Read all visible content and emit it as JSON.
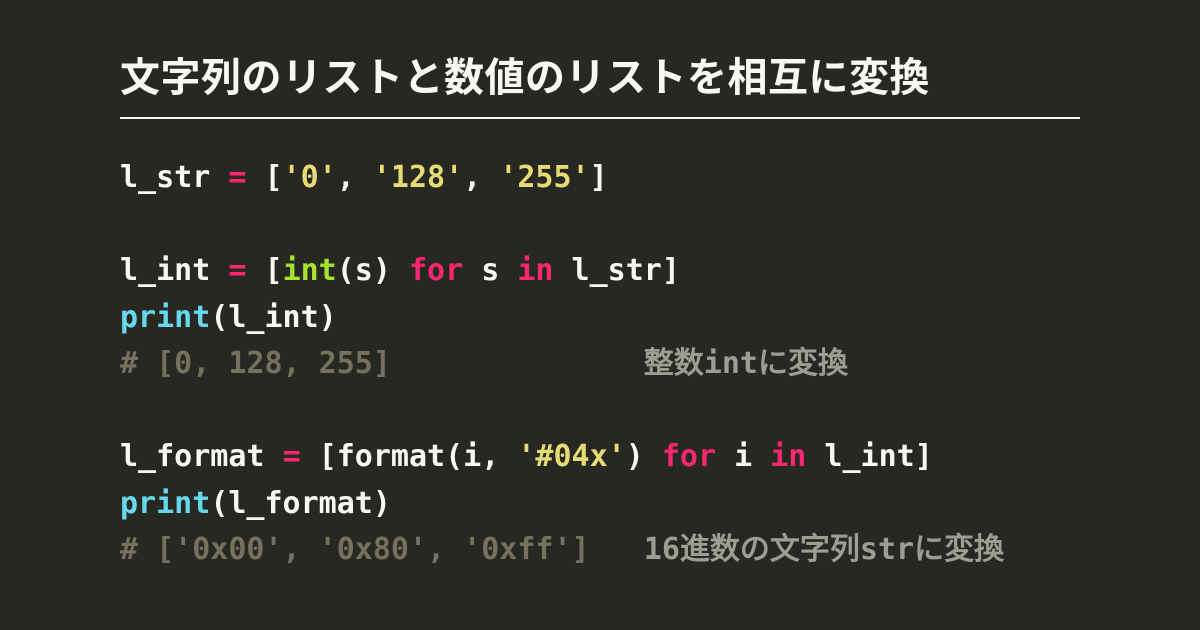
{
  "title": "文字列のリストと数値のリストを相互に変換",
  "code": {
    "lines": [
      {
        "spans": [
          {
            "cls": "tok-var",
            "t": "l_str "
          },
          {
            "cls": "tok-op",
            "t": "="
          },
          {
            "cls": "tok-punc",
            "t": " ["
          },
          {
            "cls": "tok-str",
            "t": "'0'"
          },
          {
            "cls": "tok-punc",
            "t": ", "
          },
          {
            "cls": "tok-str",
            "t": "'128'"
          },
          {
            "cls": "tok-punc",
            "t": ", "
          },
          {
            "cls": "tok-str",
            "t": "'255'"
          },
          {
            "cls": "tok-punc",
            "t": "]"
          }
        ]
      },
      {
        "spans": [
          {
            "cls": "",
            "t": ""
          }
        ]
      },
      {
        "spans": [
          {
            "cls": "tok-var",
            "t": "l_int "
          },
          {
            "cls": "tok-op",
            "t": "="
          },
          {
            "cls": "tok-punc",
            "t": " ["
          },
          {
            "cls": "tok-builtin",
            "t": "int"
          },
          {
            "cls": "tok-punc",
            "t": "(s) "
          },
          {
            "cls": "tok-kw",
            "t": "for"
          },
          {
            "cls": "tok-var",
            "t": " s "
          },
          {
            "cls": "tok-kw",
            "t": "in"
          },
          {
            "cls": "tok-var",
            "t": " l_str"
          },
          {
            "cls": "tok-punc",
            "t": "]"
          }
        ]
      },
      {
        "spans": [
          {
            "cls": "tok-fn",
            "t": "print"
          },
          {
            "cls": "tok-punc",
            "t": "(l_int)"
          }
        ]
      },
      {
        "spans": [
          {
            "cls": "tok-comment",
            "t": "# [0, 128, 255]              "
          },
          {
            "cls": "annot",
            "t": "整数intに変換"
          }
        ]
      },
      {
        "spans": [
          {
            "cls": "",
            "t": ""
          }
        ]
      },
      {
        "spans": [
          {
            "cls": "tok-var",
            "t": "l_format "
          },
          {
            "cls": "tok-op",
            "t": "="
          },
          {
            "cls": "tok-punc",
            "t": " [format(i, "
          },
          {
            "cls": "tok-str",
            "t": "'#04x'"
          },
          {
            "cls": "tok-punc",
            "t": ") "
          },
          {
            "cls": "tok-kw",
            "t": "for"
          },
          {
            "cls": "tok-var",
            "t": " i "
          },
          {
            "cls": "tok-kw",
            "t": "in"
          },
          {
            "cls": "tok-var",
            "t": " l_int"
          },
          {
            "cls": "tok-punc",
            "t": "]"
          }
        ]
      },
      {
        "spans": [
          {
            "cls": "tok-fn",
            "t": "print"
          },
          {
            "cls": "tok-punc",
            "t": "(l_format)"
          }
        ]
      },
      {
        "spans": [
          {
            "cls": "tok-comment",
            "t": "# ['0x00', '0x80', '0xff']   "
          },
          {
            "cls": "annot",
            "t": "16進数の文字列strに変換"
          }
        ]
      }
    ]
  }
}
